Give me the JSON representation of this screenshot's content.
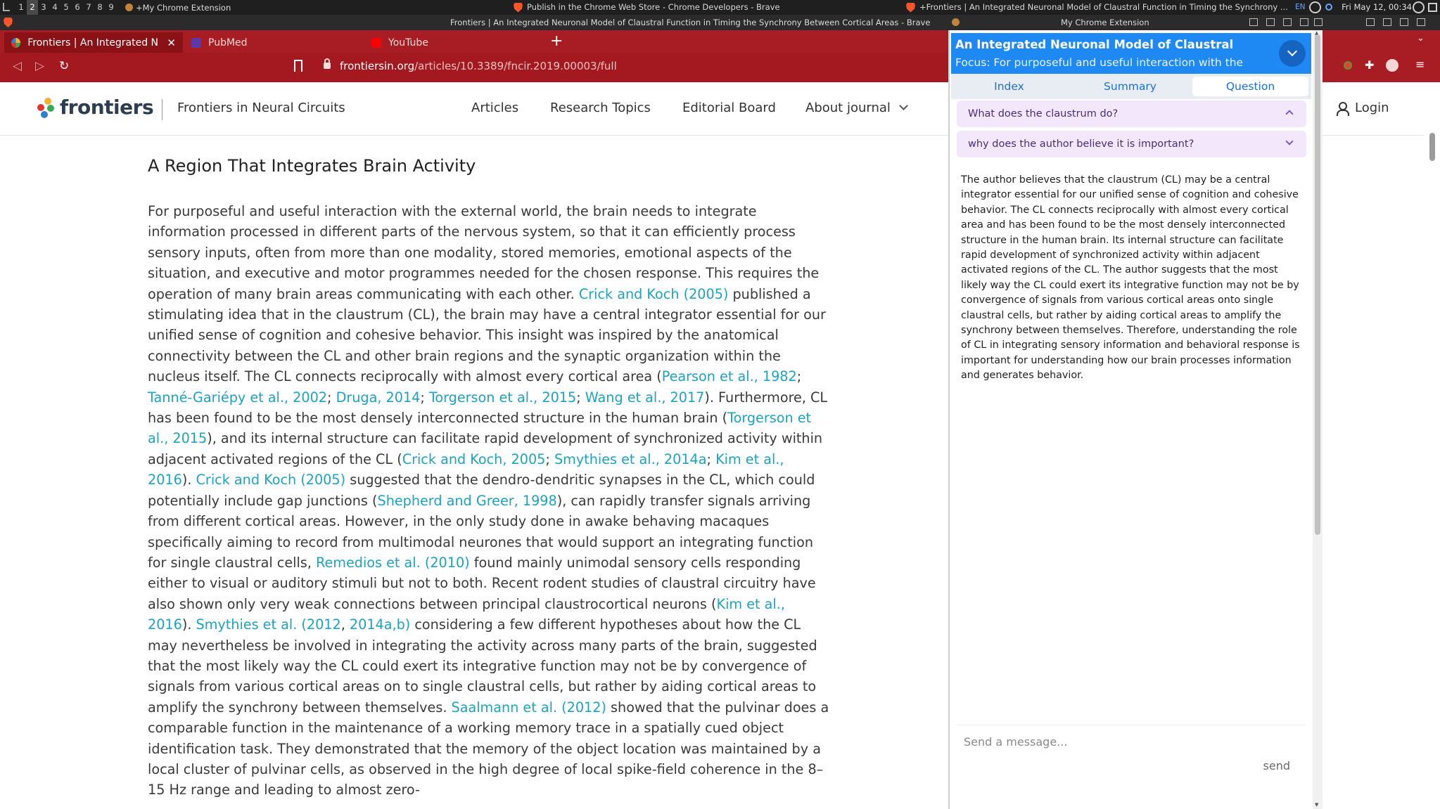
{
  "os": {
    "workspaces": [
      "1",
      "2",
      "3",
      "4",
      "5",
      "6",
      "7",
      "8",
      "9"
    ],
    "active_workspace": "2",
    "left_window_title": "+My Chrome Extension",
    "center_window_title": "Publish in the Chrome Web Store - Chrome Developers - Brave",
    "right_window_title": "+Frontiers | An Integrated Neuronal Model of Claustral Function in Timing the Synchrony ...",
    "language": "EN",
    "clock": "Fri May 12, 00:34"
  },
  "window": {
    "main_title": "Frontiers | An Integrated Neuronal Model of Claustral Function in Timing the Synchrony Between Cortical Areas - Brave",
    "side_title": "My Chrome Extension"
  },
  "browser": {
    "tabs": [
      {
        "label": "Frontiers | An Integrated Ne",
        "active": true
      },
      {
        "label": "PubMed",
        "active": false
      },
      {
        "label": "YouTube",
        "active": false
      }
    ],
    "new_tab": "+",
    "url_host": "frontiersin.org",
    "url_path": "/articles/10.3389/fncir.2019.00003/full"
  },
  "site": {
    "logo": "frontiers",
    "journal": "Frontiers in Neural Circuits",
    "nav": [
      "Articles",
      "Research Topics",
      "Editorial Board",
      "About journal"
    ],
    "login": "Login"
  },
  "article": {
    "heading": "A Region That Integrates Brain Activity",
    "segments": [
      {
        "t": "For purposeful and useful interaction with the external world, the brain needs to integrate information processed in different parts of the nervous system, so that it can efficiently process sensory inputs, often from more than one modality, stored memories, emotional aspects of the situation, and executive and motor programmes needed for the chosen response. This requires the operation of many brain areas communicating with each other. "
      },
      {
        "t": "Crick and Koch (2005)",
        "link": true
      },
      {
        "t": " published a stimulating idea that in the claustrum (CL), the brain may have a central integrator essential for our unified sense of cognition and cohesive behavior. This insight was inspired by the anatomical connectivity between the CL and other brain regions and the synaptic organization within the nucleus itself. The CL connects reciprocally with almost every cortical area ("
      },
      {
        "t": "Pearson et al., 1982",
        "link": true
      },
      {
        "t": "; "
      },
      {
        "t": "Tanné-Gariépy et al., 2002",
        "link": true
      },
      {
        "t": "; "
      },
      {
        "t": "Druga, 2014",
        "link": true
      },
      {
        "t": "; "
      },
      {
        "t": "Torgerson et al., 2015",
        "link": true
      },
      {
        "t": "; "
      },
      {
        "t": "Wang et al., 2017",
        "link": true
      },
      {
        "t": "). Furthermore, CL has been found to be the most densely interconnected structure in the human brain ("
      },
      {
        "t": "Torgerson et al., 2015",
        "link": true
      },
      {
        "t": "), and its internal structure can facilitate rapid development of synchronized activity within adjacent activated regions of the CL ("
      },
      {
        "t": "Crick and Koch, 2005",
        "link": true
      },
      {
        "t": "; "
      },
      {
        "t": "Smythies et al., 2014a",
        "link": true
      },
      {
        "t": "; "
      },
      {
        "t": "Kim et al., 2016",
        "link": true
      },
      {
        "t": "). "
      },
      {
        "t": "Crick and Koch (2005)",
        "link": true
      },
      {
        "t": " suggested that the dendro-dendritic synapses in the CL, which could potentially include gap junctions ("
      },
      {
        "t": "Shepherd and Greer, 1998",
        "link": true
      },
      {
        "t": "), can rapidly transfer signals arriving from different cortical areas. However, in the only study done in awake behaving macaques specifically aiming to record from multimodal neurones that would support an integrating function for single claustral cells, "
      },
      {
        "t": "Remedios et al. (2010)",
        "link": true
      },
      {
        "t": " found mainly unimodal sensory cells responding either to visual or auditory stimuli but not to both. Recent rodent studies of claustral circuitry have also shown only very weak connections between principal claustrocortical neurons ("
      },
      {
        "t": "Kim et al., 2016",
        "link": true
      },
      {
        "t": "). "
      },
      {
        "t": "Smythies et al. (2012",
        "link": true
      },
      {
        "t": ", "
      },
      {
        "t": "2014a,b)",
        "link": true
      },
      {
        "t": " considering a few different hypotheses about how the CL may nevertheless be involved in integrating the activity across many parts of the brain, suggested that the most likely way the CL could exert its integrative function may not be by convergence of signals from various cortical areas on to single claustral cells, but rather by aiding cortical areas to amplify the synchrony between themselves. "
      },
      {
        "t": "Saalmann et al. (2012)",
        "link": true
      },
      {
        "t": " showed that the pulvinar does a comparable function in the maintenance of a working memory trace in a spatially cued object identification task. They demonstrated that the memory of the object location was maintained by a local cluster of pulvinar cells, as observed in the high degree of local spike-field coherence in the 8–15 Hz range and leading to almost zero-"
      }
    ]
  },
  "extension": {
    "title": "An Integrated Neuronal Model of Claustral",
    "focus": "Focus: For purposeful and useful interaction with the",
    "tabs": [
      "Index",
      "Summary",
      "Question"
    ],
    "active_tab": "Question",
    "questions": [
      {
        "text": "What does the claustrum do?",
        "expanded": true
      },
      {
        "text": "why does the author believe it is important?",
        "expanded": false
      }
    ],
    "answer": "The author believes that the claustrum (CL) may be a central integrator essential for our unified sense of cognition and cohesive behavior. The CL connects reciprocally with almost every cortical area and has been found to be the most densely interconnected structure in the human brain. Its internal structure can facilitate rapid development of synchronized activity within adjacent activated regions of the CL. The author suggests that the most likely way the CL could exert its integrative function may not be by convergence of signals from various cortical areas onto single claustral cells, but rather by aiding cortical areas to amplify the synchrony between themselves. Therefore, understanding the role of CL in integrating sensory information and behavioral response is important for understanding how our brain processes information and generates behavior.",
    "input_placeholder": "Send a message...",
    "send_label": "send"
  },
  "colors": {
    "browser_chrome": "#a81d24",
    "link": "#1da3c2",
    "panel_header": "#1e88f3",
    "accordion_bg": "#f3e8fb"
  }
}
